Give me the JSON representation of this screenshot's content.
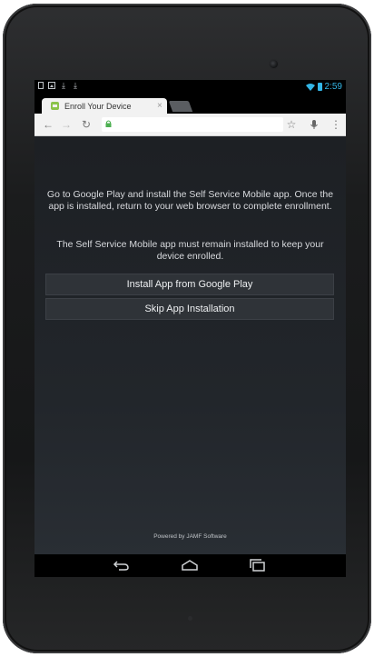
{
  "status_bar": {
    "time": "2:59"
  },
  "browser": {
    "tab_title": "Enroll Your Device",
    "tab_close": "×",
    "url": ""
  },
  "page": {
    "message_primary": "Go to Google Play and install the Self Service Mobile app. Once the app is installed, return to your web browser to complete enrollment.",
    "message_secondary": "The Self Service Mobile app must remain installed to keep your device enrolled.",
    "install_button": "Install App from Google Play",
    "skip_button": "Skip App Installation",
    "footer": "Powered by JAMF Software"
  },
  "colors": {
    "status_accent": "#33b5e5",
    "page_background": "#1d2024",
    "button_background": "#2f3338"
  },
  "icons": [
    "back-icon",
    "forward-icon",
    "reload-icon",
    "lock-icon",
    "star-icon",
    "mic-icon",
    "menu-icon",
    "nav-back-icon",
    "nav-home-icon",
    "nav-recents-icon"
  ]
}
